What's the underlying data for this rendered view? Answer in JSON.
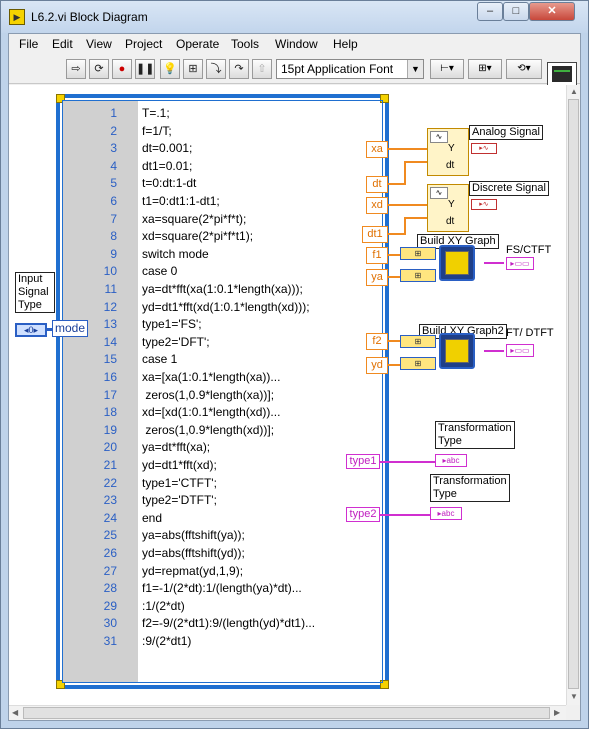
{
  "window": {
    "title": "L6.2.vi Block Diagram",
    "min": "–",
    "max": "□",
    "close": "✕"
  },
  "menu": [
    "File",
    "Edit",
    "View",
    "Project",
    "Operate",
    "Tools",
    "Window",
    "Help"
  ],
  "toolbar": {
    "font": "15pt Application Font"
  },
  "math_script": {
    "lines": [
      {
        "n": "1",
        "code": "T=.1;"
      },
      {
        "n": "2",
        "code": "f=1/T;"
      },
      {
        "n": "3",
        "code": "dt=0.001;"
      },
      {
        "n": "4",
        "code": "dt1=0.01;"
      },
      {
        "n": "5",
        "code": "t=0:dt:1-dt"
      },
      {
        "n": "6",
        "code": "t1=0:dt1:1-dt1;"
      },
      {
        "n": "7",
        "code": "xa=square(2*pi*f*t);"
      },
      {
        "n": "8",
        "code": "xd=square(2*pi*f*t1);"
      },
      {
        "n": "9",
        "code": "switch mode"
      },
      {
        "n": "10",
        "code": "case 0"
      },
      {
        "n": "11",
        "code": "ya=dt*fft(xa(1:0.1*length(xa)));"
      },
      {
        "n": "12",
        "code": "yd=dt1*fft(xd(1:0.1*length(xd)));"
      },
      {
        "n": "13",
        "code": "type1='FS';"
      },
      {
        "n": "14",
        "code": "type2='DFT';"
      },
      {
        "n": "15",
        "code": "case 1"
      },
      {
        "n": "16",
        "code": "xa=[xa(1:0.1*length(xa))..."
      },
      {
        "n": "17",
        "code": " zeros(1,0.9*length(xa))];"
      },
      {
        "n": "18",
        "code": "xd=[xd(1:0.1*length(xd))..."
      },
      {
        "n": "19",
        "code": " zeros(1,0.9*length(xd))];"
      },
      {
        "n": "20",
        "code": "ya=dt*fft(xa);"
      },
      {
        "n": "21",
        "code": "yd=dt1*fft(xd);"
      },
      {
        "n": "22",
        "code": "type1='CTFT';"
      },
      {
        "n": "23",
        "code": "type2='DTFT';"
      },
      {
        "n": "24",
        "code": "end"
      },
      {
        "n": "25",
        "code": "ya=abs(fftshift(ya));"
      },
      {
        "n": "26",
        "code": "yd=abs(fftshift(yd));"
      },
      {
        "n": "27",
        "code": "yd=repmat(yd,1,9);"
      },
      {
        "n": "28",
        "code": "f1=-1/(2*dt):1/(length(ya)*dt)..."
      },
      {
        "n": "29",
        "code": ":1/(2*dt)"
      },
      {
        "n": "30",
        "code": "f2=-9/(2*dt1):9/(length(yd)*dt1)..."
      },
      {
        "n": "31",
        "code": ":9/(2*dt1)"
      }
    ]
  },
  "diagram": {
    "input_label": "Input\nSignal\nType",
    "mode_ctrl": "◂0▸",
    "mode_tunnel": "mode",
    "out_terms": [
      "xa",
      "dt",
      "xd",
      "dt1",
      "f1",
      "ya",
      "f2",
      "yd"
    ],
    "type_terms": [
      "type1",
      "type2"
    ],
    "labels": {
      "analog": "Analog Signal",
      "discrete": "Discrete Signal",
      "bxy1": "Build XY Graph",
      "bxy2": "Build XY Graph2",
      "fsctft": "FS/CTFT",
      "ftdtft": "FT/ DTFT",
      "tt1": "Transformation\nType",
      "tt2": "Transformation\nType"
    },
    "wf_letters": {
      "y": "Y",
      "dt": "dt"
    },
    "ind_abc": "▸abc",
    "ind_xy": "▸▭▭"
  }
}
